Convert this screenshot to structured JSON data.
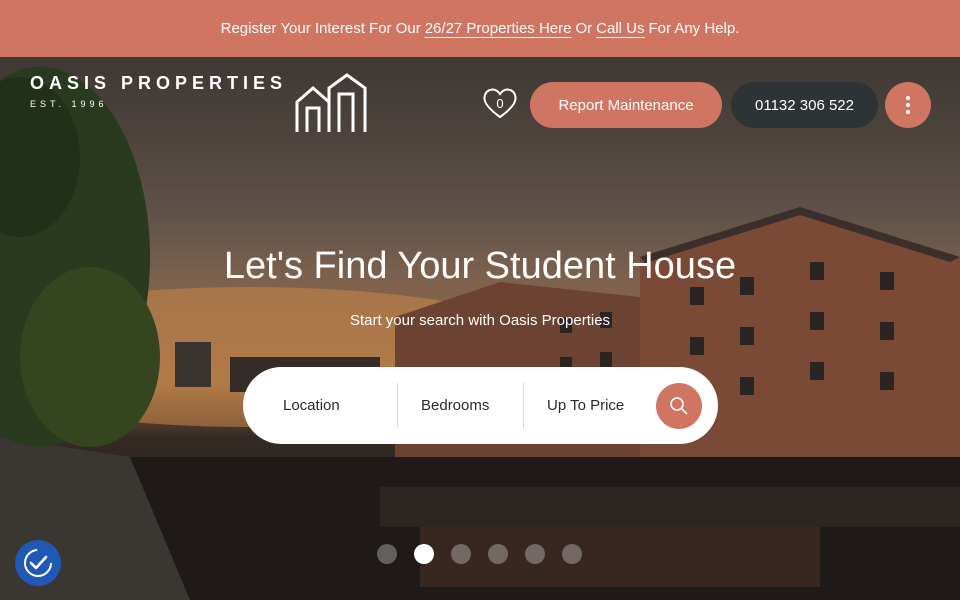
{
  "banner": {
    "prefix": "Register Your Interest For Our",
    "link_properties": "26/27 Properties Here",
    "middle": "Or",
    "link_call": "Call Us",
    "suffix": "For Any Help."
  },
  "logo": {
    "name": "OASIS PROPERTIES",
    "est": "EST. 1996"
  },
  "header": {
    "favourites_count": "0",
    "report_label": "Report Maintenance",
    "phone_label": "01132 306 522"
  },
  "hero": {
    "title": "Let's Find Your Student House",
    "subtitle": "Start your search with Oasis Properties"
  },
  "search": {
    "location_label": "Location",
    "bedrooms_label": "Bedrooms",
    "price_label": "Up To Price"
  },
  "carousel": {
    "slide_count": 6,
    "active_index": 1
  },
  "colors": {
    "accent": "#cf7562",
    "dark_button": "#2e3436",
    "accessibility": "#1f58b5"
  },
  "icons": [
    "heart-icon",
    "house-logo-icon",
    "menu-dots-icon",
    "search-icon",
    "accessibility-icon"
  ]
}
